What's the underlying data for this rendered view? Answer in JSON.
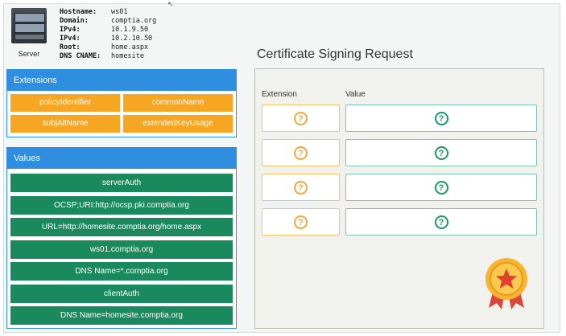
{
  "server": {
    "label": "Server",
    "details": [
      {
        "key": "Hostname:",
        "value": "ws01"
      },
      {
        "key": "Domain:",
        "value": "comptia.org"
      },
      {
        "key": "IPv4:",
        "value": "10.1.9.50"
      },
      {
        "key": "IPv4:",
        "value": "10.2.10.50"
      },
      {
        "key": "Root:",
        "value": "home.aspx"
      },
      {
        "key": "DNS CNAME:",
        "value": "homesite"
      }
    ]
  },
  "extensions": {
    "title": "Extensions",
    "items": [
      "policyIdentifier",
      "commonName",
      "subjAltName",
      "extendedKeyUsage"
    ]
  },
  "values": {
    "title": "Values",
    "items": [
      "serverAuth",
      "OCSP;URI:http://ocsp.pki.comptia.org",
      "URL=http://homesite.comptia.org/home.aspx",
      "ws01.comptia.org",
      "DNS Name=*.comptia.org",
      "clientAuth",
      "DNS Name=homesite.comptia.org"
    ]
  },
  "csr": {
    "title": "Certificate Signing Request",
    "col_extension": "Extension",
    "col_value": "Value",
    "placeholder": "?"
  },
  "colors": {
    "header_blue": "#2f8ee0",
    "extension_orange": "#f7a624",
    "value_green": "#1a8a5e"
  },
  "icons": {
    "server": "server-icon",
    "placeholder": "question-mark-icon",
    "badge": "award-ribbon-icon"
  }
}
